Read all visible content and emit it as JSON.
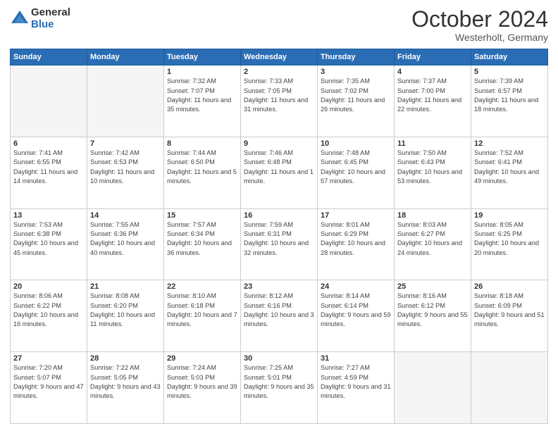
{
  "logo": {
    "general": "General",
    "blue": "Blue"
  },
  "header": {
    "month": "October 2024",
    "location": "Westerholt, Germany"
  },
  "days_of_week": [
    "Sunday",
    "Monday",
    "Tuesday",
    "Wednesday",
    "Thursday",
    "Friday",
    "Saturday"
  ],
  "weeks": [
    [
      {
        "day": "",
        "info": ""
      },
      {
        "day": "",
        "info": ""
      },
      {
        "day": "1",
        "info": "Sunrise: 7:32 AM\nSunset: 7:07 PM\nDaylight: 11 hours and 35 minutes."
      },
      {
        "day": "2",
        "info": "Sunrise: 7:33 AM\nSunset: 7:05 PM\nDaylight: 11 hours and 31 minutes."
      },
      {
        "day": "3",
        "info": "Sunrise: 7:35 AM\nSunset: 7:02 PM\nDaylight: 11 hours and 26 minutes."
      },
      {
        "day": "4",
        "info": "Sunrise: 7:37 AM\nSunset: 7:00 PM\nDaylight: 11 hours and 22 minutes."
      },
      {
        "day": "5",
        "info": "Sunrise: 7:39 AM\nSunset: 6:57 PM\nDaylight: 11 hours and 18 minutes."
      }
    ],
    [
      {
        "day": "6",
        "info": "Sunrise: 7:41 AM\nSunset: 6:55 PM\nDaylight: 11 hours and 14 minutes."
      },
      {
        "day": "7",
        "info": "Sunrise: 7:42 AM\nSunset: 6:53 PM\nDaylight: 11 hours and 10 minutes."
      },
      {
        "day": "8",
        "info": "Sunrise: 7:44 AM\nSunset: 6:50 PM\nDaylight: 11 hours and 5 minutes."
      },
      {
        "day": "9",
        "info": "Sunrise: 7:46 AM\nSunset: 6:48 PM\nDaylight: 11 hours and 1 minute."
      },
      {
        "day": "10",
        "info": "Sunrise: 7:48 AM\nSunset: 6:45 PM\nDaylight: 10 hours and 57 minutes."
      },
      {
        "day": "11",
        "info": "Sunrise: 7:50 AM\nSunset: 6:43 PM\nDaylight: 10 hours and 53 minutes."
      },
      {
        "day": "12",
        "info": "Sunrise: 7:52 AM\nSunset: 6:41 PM\nDaylight: 10 hours and 49 minutes."
      }
    ],
    [
      {
        "day": "13",
        "info": "Sunrise: 7:53 AM\nSunset: 6:38 PM\nDaylight: 10 hours and 45 minutes."
      },
      {
        "day": "14",
        "info": "Sunrise: 7:55 AM\nSunset: 6:36 PM\nDaylight: 10 hours and 40 minutes."
      },
      {
        "day": "15",
        "info": "Sunrise: 7:57 AM\nSunset: 6:34 PM\nDaylight: 10 hours and 36 minutes."
      },
      {
        "day": "16",
        "info": "Sunrise: 7:59 AM\nSunset: 6:31 PM\nDaylight: 10 hours and 32 minutes."
      },
      {
        "day": "17",
        "info": "Sunrise: 8:01 AM\nSunset: 6:29 PM\nDaylight: 10 hours and 28 minutes."
      },
      {
        "day": "18",
        "info": "Sunrise: 8:03 AM\nSunset: 6:27 PM\nDaylight: 10 hours and 24 minutes."
      },
      {
        "day": "19",
        "info": "Sunrise: 8:05 AM\nSunset: 6:25 PM\nDaylight: 10 hours and 20 minutes."
      }
    ],
    [
      {
        "day": "20",
        "info": "Sunrise: 8:06 AM\nSunset: 6:22 PM\nDaylight: 10 hours and 16 minutes."
      },
      {
        "day": "21",
        "info": "Sunrise: 8:08 AM\nSunset: 6:20 PM\nDaylight: 10 hours and 11 minutes."
      },
      {
        "day": "22",
        "info": "Sunrise: 8:10 AM\nSunset: 6:18 PM\nDaylight: 10 hours and 7 minutes."
      },
      {
        "day": "23",
        "info": "Sunrise: 8:12 AM\nSunset: 6:16 PM\nDaylight: 10 hours and 3 minutes."
      },
      {
        "day": "24",
        "info": "Sunrise: 8:14 AM\nSunset: 6:14 PM\nDaylight: 9 hours and 59 minutes."
      },
      {
        "day": "25",
        "info": "Sunrise: 8:16 AM\nSunset: 6:12 PM\nDaylight: 9 hours and 55 minutes."
      },
      {
        "day": "26",
        "info": "Sunrise: 8:18 AM\nSunset: 6:09 PM\nDaylight: 9 hours and 51 minutes."
      }
    ],
    [
      {
        "day": "27",
        "info": "Sunrise: 7:20 AM\nSunset: 5:07 PM\nDaylight: 9 hours and 47 minutes."
      },
      {
        "day": "28",
        "info": "Sunrise: 7:22 AM\nSunset: 5:05 PM\nDaylight: 9 hours and 43 minutes."
      },
      {
        "day": "29",
        "info": "Sunrise: 7:24 AM\nSunset: 5:03 PM\nDaylight: 9 hours and 39 minutes."
      },
      {
        "day": "30",
        "info": "Sunrise: 7:25 AM\nSunset: 5:01 PM\nDaylight: 9 hours and 35 minutes."
      },
      {
        "day": "31",
        "info": "Sunrise: 7:27 AM\nSunset: 4:59 PM\nDaylight: 9 hours and 31 minutes."
      },
      {
        "day": "",
        "info": ""
      },
      {
        "day": "",
        "info": ""
      }
    ]
  ]
}
